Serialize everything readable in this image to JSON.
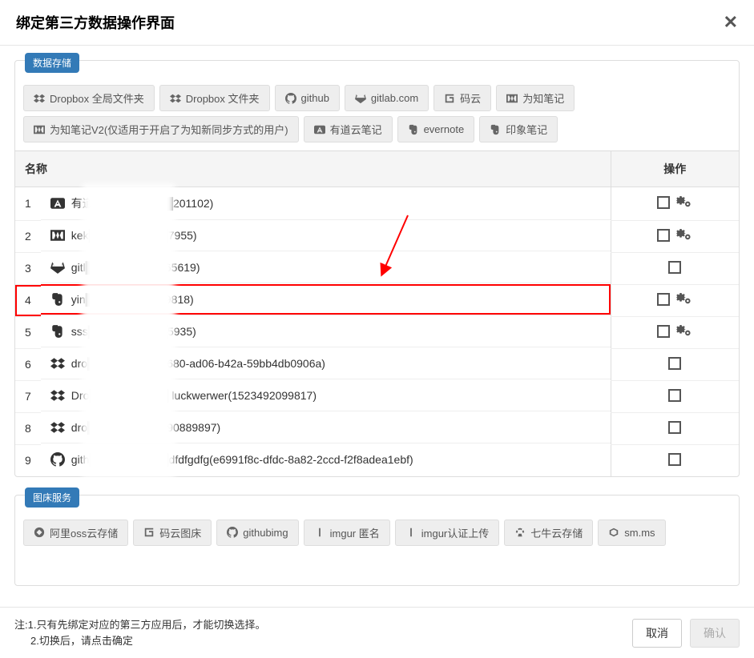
{
  "header": {
    "title": "绑定第三方数据操作界面"
  },
  "panel_storage": {
    "label": "数据存储",
    "buttons": [
      {
        "icon": "dropbox",
        "label": "Dropbox 全局文件夹"
      },
      {
        "icon": "dropbox",
        "label": "Dropbox 文件夹"
      },
      {
        "icon": "github",
        "label": "github"
      },
      {
        "icon": "gitlab",
        "label": "gitlab.com"
      },
      {
        "icon": "mayun",
        "label": "码云"
      },
      {
        "icon": "wiz",
        "label": "为知笔记"
      },
      {
        "icon": "wiz",
        "label": "为知笔记V2(仅适用于开启了为知新同步方式的用户)"
      },
      {
        "icon": "youdao",
        "label": "有道云笔记"
      },
      {
        "icon": "evernote",
        "label": "evernote"
      },
      {
        "icon": "evernote",
        "label": "印象笔记"
      }
    ],
    "table": {
      "col_name": "名称",
      "col_ops": "操作",
      "rows": [
        {
          "idx": "1",
          "icon": "youdao",
          "text": "有道██████████201102)",
          "gear": true,
          "highlight": false
        },
        {
          "idx": "2",
          "icon": "wiz",
          "text": "kek██████████7955)",
          "gear": true,
          "highlight": false
        },
        {
          "idx": "3",
          "icon": "gitlab",
          "text": "gitl██████████65619)",
          "gear": false,
          "highlight": false
        },
        {
          "idx": "4",
          "icon": "evernote",
          "text": "yin██████████9818)",
          "gear": true,
          "highlight": true
        },
        {
          "idx": "5",
          "icon": "evernote",
          "text": "sss██████████5935)",
          "gear": true,
          "highlight": false
        },
        {
          "idx": "6",
          "icon": "dropbox",
          "text": "dro██████████680-ad06-b42a-59bb4db0906a)",
          "gear": false,
          "highlight": false
        },
        {
          "idx": "7",
          "icon": "dropbox",
          "text": "Dro██████████ luckwerwer(1523492099817)",
          "gear": false,
          "highlight": false
        },
        {
          "idx": "8",
          "icon": "dropbox",
          "text": "dro██████████90889897)",
          "gear": false,
          "highlight": false
        },
        {
          "idx": "9",
          "icon": "github",
          "text": "gith██████████dfdfgdfg(e6991f8c-dfdc-8a82-2ccd-f2f8adea1ebf)",
          "gear": false,
          "highlight": false
        }
      ]
    }
  },
  "panel_imgbed": {
    "label": "图床服务",
    "buttons": [
      {
        "icon": "aliyun",
        "label": "阿里oss云存储"
      },
      {
        "icon": "mayun",
        "label": "码云图床"
      },
      {
        "icon": "github",
        "label": "githubimg"
      },
      {
        "icon": "imgur",
        "label": "imgur 匿名"
      },
      {
        "icon": "imgur",
        "label": "imgur认证上传"
      },
      {
        "icon": "qiniu",
        "label": "七牛云存储"
      },
      {
        "icon": "smms",
        "label": "sm.ms"
      }
    ]
  },
  "footer": {
    "note_l1": "注:1.只有先绑定对应的第三方应用后，才能切换选择。",
    "note_l2": "2.切换后，请点击确定",
    "cancel": "取消",
    "confirm": "确认"
  }
}
